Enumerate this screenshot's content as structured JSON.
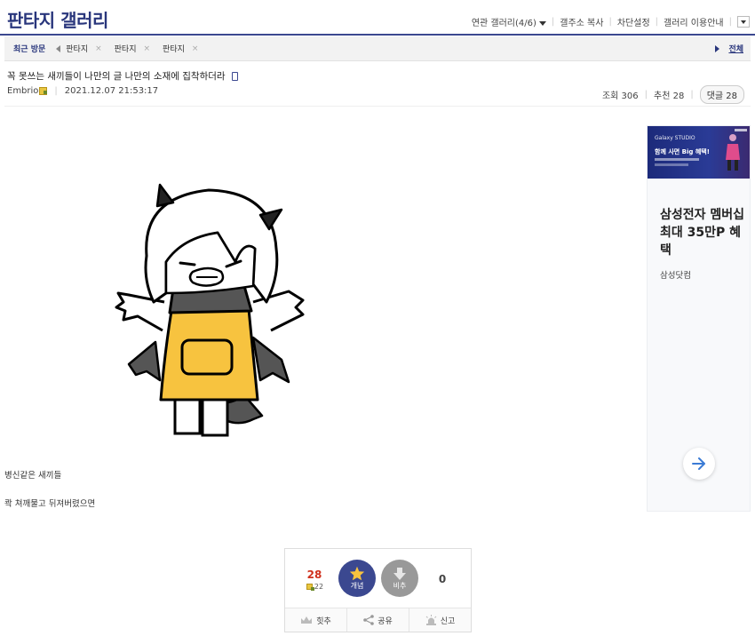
{
  "gallery": {
    "title": "판타지 갤러리",
    "util": {
      "related": "연관 갤러리(4/6)",
      "copy_address": "갤주소 복사",
      "block_settings": "차단설정",
      "guide": "갤러리 이용안내"
    }
  },
  "recent_visits": {
    "title": "최근 방문",
    "items": [
      "판타지",
      "판타지",
      "판타지"
    ],
    "close_glyph": "×",
    "all_label": "전체"
  },
  "post": {
    "title": "꼭 못쓰는 새끼들이 나만의 글 나만의 소재에 집착하더라",
    "author": "Embrio",
    "date": "2021.12.07 21:53:17",
    "views_label": "조회 306",
    "recommend_label": "추천 28",
    "comments_label": "댓글 28",
    "body_lines": [
      "병신같은 새끼들",
      "콱 쳐깨물고 뒤져버렸으면"
    ]
  },
  "ad": {
    "banner_brand": "Galaxy STUDIO",
    "banner_headline": "함께 사면 Big 혜택!",
    "headline": "삼성전자 멤버십 최대 35만P 혜택",
    "advertiser": "삼성닷컴"
  },
  "recommend": {
    "up_count": "28",
    "fixed_count": "22",
    "up_label": "개념",
    "down_label": "비추",
    "down_count": "0",
    "hit_label": "힛추",
    "share_label": "공유",
    "report_label": "신고"
  },
  "colors": {
    "brand": "#29367c",
    "up_button": "#3b4890",
    "down_button": "#999999",
    "up_count": "#d0311d",
    "apron": "#f7c33f"
  },
  "icons": [
    "mobile-icon",
    "gonick-icon",
    "arrow-right-icon",
    "star-icon",
    "down-arrow-icon",
    "crown-icon",
    "share-icon",
    "siren-icon"
  ]
}
